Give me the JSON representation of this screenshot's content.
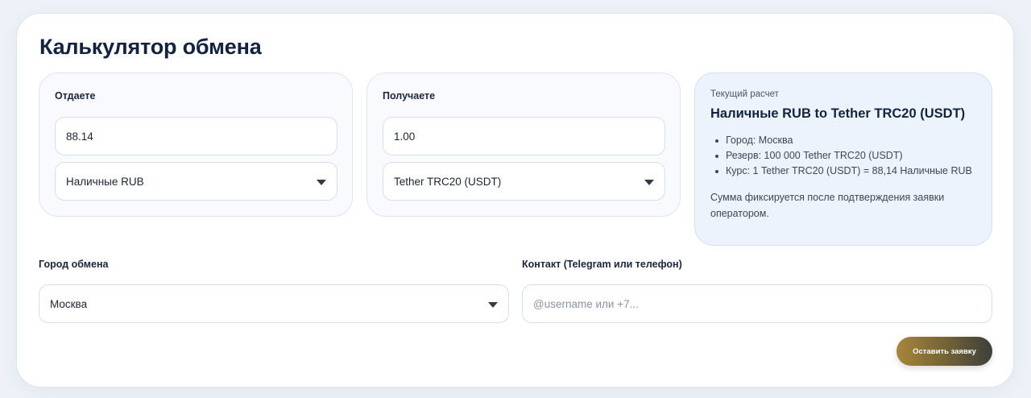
{
  "page": {
    "title": "Калькулятор обмена"
  },
  "give": {
    "label": "Отдаете",
    "amount": "88.14",
    "currency": "Наличные RUB"
  },
  "get": {
    "label": "Получаете",
    "amount": "1.00",
    "currency": "Tether TRC20 (USDT)"
  },
  "summary": {
    "caption": "Текущий расчет",
    "title": "Наличные RUB to Tether TRC20 (USDT)",
    "items": [
      "Город: Москва",
      "Резерв: 100 000 Tether TRC20 (USDT)",
      "Курс: 1 Tether TRC20 (USDT) = 88,14 Наличные RUB"
    ],
    "note": "Сумма фиксируется после подтверждения заявки оператором."
  },
  "city": {
    "label": "Город обмена",
    "value": "Москва"
  },
  "contact": {
    "label": "Контакт (Telegram или телефон)",
    "placeholder": "@username или +7..."
  },
  "submit": {
    "label": "Оставить заявку"
  },
  "colors": {
    "title": "#13233f",
    "summary_bg": "#edf3fd",
    "button_start": "#a8863a",
    "button_end": "#3e3f3c"
  },
  "icons": {
    "select_caret": "chevron-down-icon"
  }
}
